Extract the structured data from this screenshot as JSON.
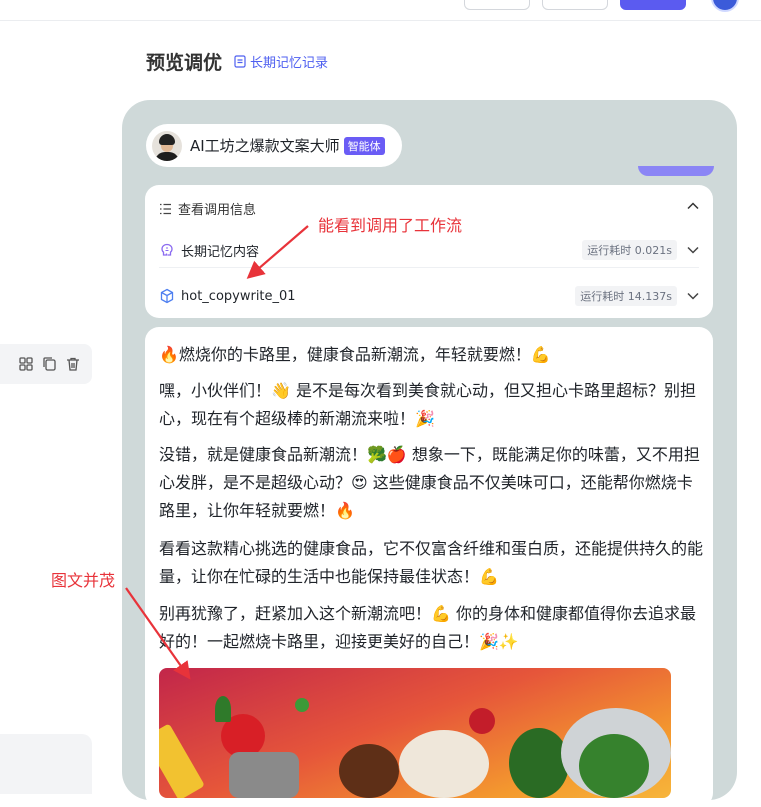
{
  "section_title": "预览调优",
  "memory_link": "长期记忆记录",
  "agent": {
    "name": "AI工坊之爆款文案大师",
    "badge": "智能体"
  },
  "call_info": {
    "header": "查看调用信息",
    "rows": [
      {
        "label": "长期记忆内容",
        "time": "运行耗时 0.021s"
      },
      {
        "label": "hot_copywrite_01",
        "time": "运行耗时 14.137s"
      }
    ]
  },
  "message": {
    "paragraphs": [
      "🔥燃烧你的卡路里，健康食品新潮流，年轻就要燃！💪",
      "嘿，小伙伴们！👋 是不是每次看到美食就心动，但又担心卡路里超标？别担心，现在有个超级棒的新潮流来啦！🎉",
      "没错，就是健康食品新潮流！🥦🍎 想象一下，既能满足你的味蕾，又不用担心发胖，是不是超级心动？😍 这些健康食品不仅美味可口，还能帮你燃烧卡路里，让你年轻就要燃！🔥",
      "看看这款精心挑选的健康食品，它不仅富含纤维和蛋白质，还能提供持久的能量，让你在忙碌的生活中也能保持最佳状态！💪",
      "别再犹豫了，赶紧加入这个新潮流吧！💪 你的身体和健康都值得你去追求最好的！一起燃烧卡路里，迎接更美好的自己！🎉✨"
    ]
  },
  "annotations": {
    "workflow": "能看到调用了工作流",
    "image_text": "图文并茂"
  },
  "colors": {
    "accent": "#4e5ff0",
    "annotation": "#e8333a",
    "badge": "#6a5cf5"
  },
  "icons": [
    "grid-icon",
    "copy-icon",
    "trash-icon",
    "document-icon",
    "list-icon",
    "brain-icon",
    "workflow-cube-icon",
    "chevron-up-icon",
    "chevron-down-icon"
  ]
}
